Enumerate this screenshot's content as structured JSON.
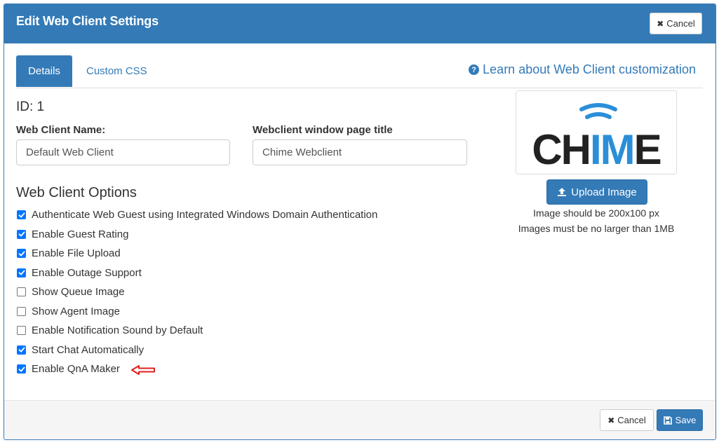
{
  "header": {
    "title": "Edit Web Client Settings",
    "cancel_label": "Cancel"
  },
  "tabs": [
    {
      "label": "Details",
      "active": true
    },
    {
      "label": "Custom CSS",
      "active": false
    }
  ],
  "learn_link": "Learn about Web Client customization",
  "id_label": "ID: 1",
  "fields": {
    "name": {
      "label": "Web Client Name:",
      "value": "Default Web Client"
    },
    "title": {
      "label": "Webclient window page title",
      "value": "Chime Webclient"
    }
  },
  "options_heading": "Web Client Options",
  "options": [
    {
      "label": "Authenticate Web Guest using Integrated Windows Domain Authentication",
      "checked": true
    },
    {
      "label": "Enable Guest Rating",
      "checked": true
    },
    {
      "label": "Enable File Upload",
      "checked": true
    },
    {
      "label": "Enable Outage Support",
      "checked": true
    },
    {
      "label": "Show Queue Image",
      "checked": false
    },
    {
      "label": "Show Agent Image",
      "checked": false
    },
    {
      "label": "Enable Notification Sound by Default",
      "checked": false
    },
    {
      "label": "Start Chat Automatically",
      "checked": true
    },
    {
      "label": "Enable QnA Maker",
      "checked": true
    }
  ],
  "logo": {
    "text": "CHIME",
    "color_dark": "#222222",
    "color_accent": "#2a8fd8"
  },
  "upload": {
    "button_label": "Upload Image",
    "hint_size": "Image should be 200x100 px",
    "hint_max": "Images must be no larger than 1MB"
  },
  "footer": {
    "cancel_label": "Cancel",
    "save_label": "Save"
  },
  "colors": {
    "primary": "#337ab7",
    "annotation_arrow": "#e02020"
  }
}
